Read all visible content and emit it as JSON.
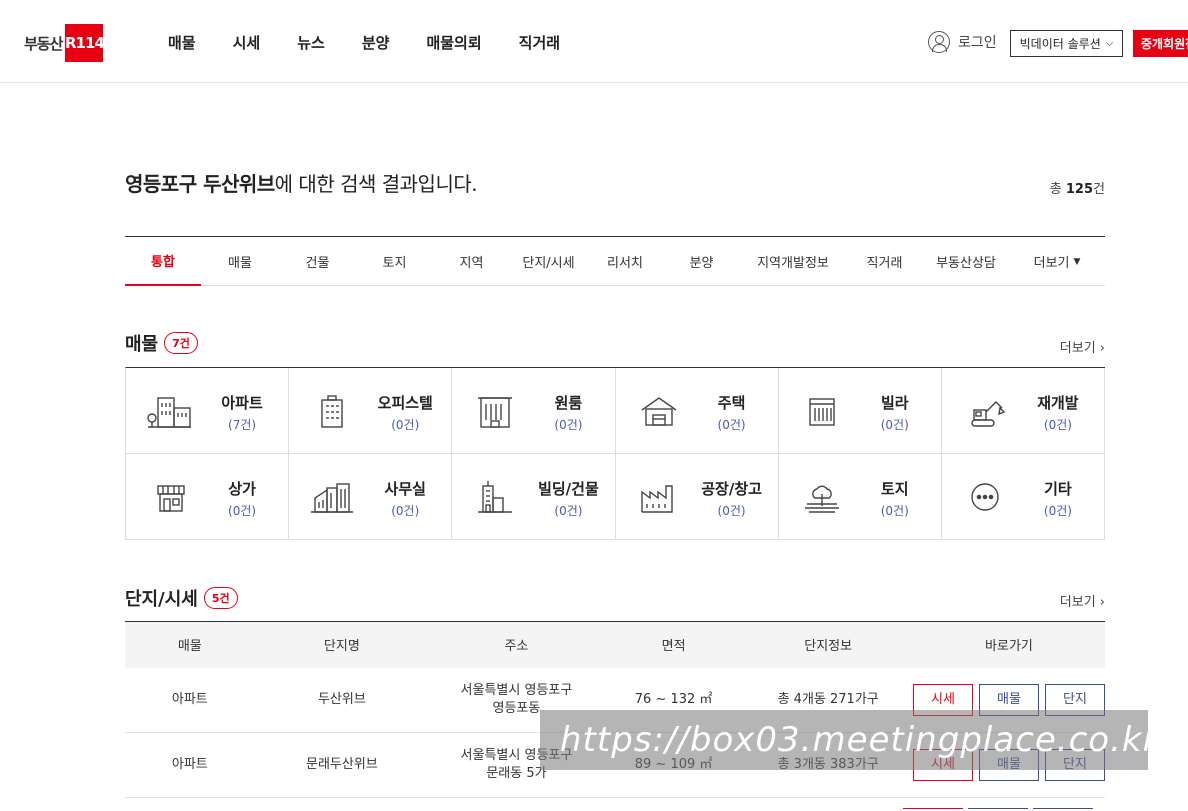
{
  "header": {
    "logo_text": "부동산",
    "logo_box": "R114",
    "nav": [
      "매물",
      "시세",
      "뉴스",
      "분양",
      "매물의뢰",
      "직거래"
    ],
    "login_label": "로그인",
    "bigdata_label": "빅데이터 솔루션",
    "agent_label": "중개회원전"
  },
  "search": {
    "keyword": "영등포구 두산위브",
    "suffix": "에 대한 검색 결과입니다.",
    "total_prefix": "총 ",
    "total_count": "125",
    "total_suffix": "건"
  },
  "tabs": [
    {
      "label": "통합",
      "active": true
    },
    {
      "label": "매물"
    },
    {
      "label": "건물"
    },
    {
      "label": "토지"
    },
    {
      "label": "지역"
    },
    {
      "label": "단지/시세"
    },
    {
      "label": "리서치"
    },
    {
      "label": "분양"
    },
    {
      "label": "지역개발정보"
    },
    {
      "label": "직거래"
    },
    {
      "label": "부동산상담"
    },
    {
      "label": "더보기"
    }
  ],
  "listings": {
    "title": "매물",
    "count": "7건",
    "more": "더보기 ›",
    "categories": [
      {
        "name": "아파트",
        "count": "(7건)",
        "icon": "apartment-icon"
      },
      {
        "name": "오피스텔",
        "count": "(0건)",
        "icon": "officetel-icon"
      },
      {
        "name": "원룸",
        "count": "(0건)",
        "icon": "oneroom-icon"
      },
      {
        "name": "주택",
        "count": "(0건)",
        "icon": "house-icon"
      },
      {
        "name": "빌라",
        "count": "(0건)",
        "icon": "villa-icon"
      },
      {
        "name": "재개발",
        "count": "(0건)",
        "icon": "excavator-icon"
      },
      {
        "name": "상가",
        "count": "(0건)",
        "icon": "store-icon"
      },
      {
        "name": "사무실",
        "count": "(0건)",
        "icon": "office-icon"
      },
      {
        "name": "빌딩/건물",
        "count": "(0건)",
        "icon": "building-icon"
      },
      {
        "name": "공장/창고",
        "count": "(0건)",
        "icon": "factory-icon"
      },
      {
        "name": "토지",
        "count": "(0건)",
        "icon": "land-icon"
      },
      {
        "name": "기타",
        "count": "(0건)",
        "icon": "more-icon"
      }
    ]
  },
  "complex": {
    "title": "단지/시세",
    "count": "5건",
    "more": "더보기 ›",
    "headers": [
      "매물",
      "단지명",
      "주소",
      "면적",
      "단지정보",
      "바로가기"
    ],
    "rows": [
      {
        "type": "아파트",
        "name": "두산위브",
        "address": "서울특별시 영등포구 영등포동",
        "area": "76 ~ 132 ㎡",
        "info": "총 4개동 271가구"
      },
      {
        "type": "아파트",
        "name": "문래두산위브",
        "address": "서울특별시 영등포구 문래동 5가",
        "area": "89 ~ 109 ㎡",
        "info": "총 3개동 383가구"
      }
    ],
    "buttons": {
      "price": "시세",
      "listing": "매물",
      "complex": "단지"
    }
  },
  "watermark": "https://box03.meetingplace.co.kr",
  "colors": {
    "accent": "#e60012",
    "blue": "#3a4a9c"
  }
}
